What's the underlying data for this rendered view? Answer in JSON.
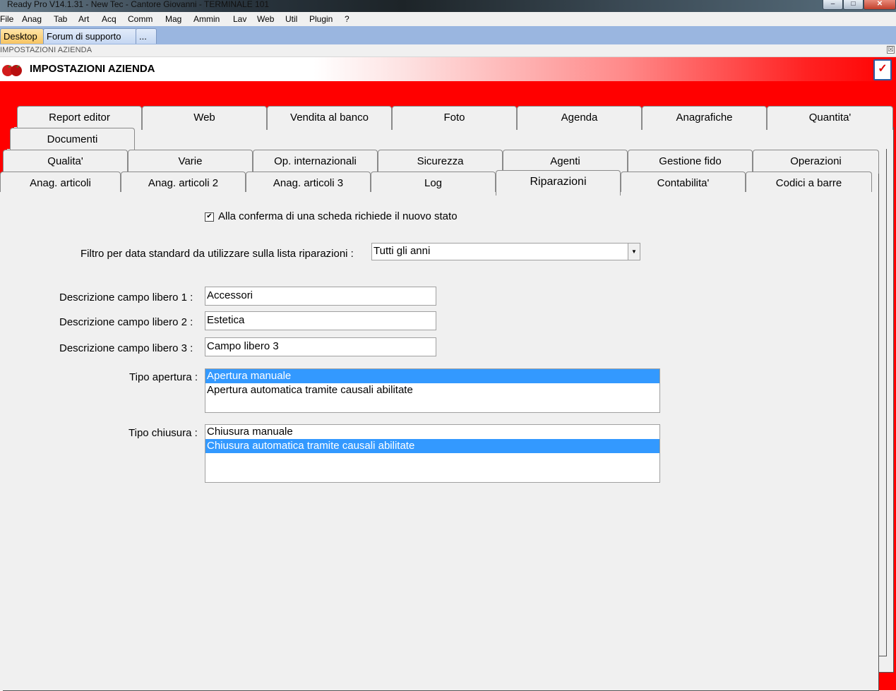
{
  "window": {
    "title": "Ready Pro V14.1.31 - New Tec - Cantore Giovanni - TERMINALE 101",
    "minimize": "–",
    "maximize": "□",
    "close": "✕"
  },
  "menu": [
    "File",
    "Anag",
    "Tab",
    "Art",
    "Acq",
    "Comm",
    "Mag",
    "Ammin",
    "Lav",
    "Web",
    "Util",
    "Plugin",
    "?"
  ],
  "doc_tabs": [
    {
      "label": "Desktop",
      "active": true
    },
    {
      "label": "Forum di supporto",
      "active": false
    },
    {
      "label": "...",
      "active": false
    }
  ],
  "caption": {
    "title": "IMPOSTAZIONI AZIENDA",
    "close": "☒"
  },
  "header": {
    "title": "IMPOSTAZIONI AZIENDA",
    "confirm_icon": "checklist-icon"
  },
  "tabs": {
    "row1": [
      "Report editor",
      "Web",
      "Vendita al banco",
      "Foto",
      "Agenda",
      "Anagrafiche",
      "Quantita'"
    ],
    "row2": [
      "Documenti"
    ],
    "row3": [
      "Qualita'",
      "Varie",
      "Op. internazionali",
      "Sicurezza",
      "Agenti",
      "Gestione fido",
      "Operazioni"
    ],
    "row4": [
      "Anag. articoli",
      "Anag. articoli 2",
      "Anag. articoli 3",
      "Log",
      "Riparazioni",
      "Contabilita'",
      "Codici a barre"
    ],
    "active": "Riparazioni"
  },
  "form": {
    "checkbox_label": "Alla conferma di una scheda richiede il nuovo stato",
    "checkbox_checked": true,
    "filter_label": "Filtro per data standard da utilizzare sulla lista riparazioni :",
    "filter_value": "Tutti gli anni",
    "field1_label": "Descrizione campo libero 1 :",
    "field1_value": "Accessori",
    "field2_label": "Descrizione campo libero 2 :",
    "field2_value": "Estetica",
    "field3_label": "Descrizione campo libero 3 :",
    "field3_value": "Campo libero 3",
    "apertura_label": "Tipo apertura :",
    "apertura_options": [
      "Apertura manuale",
      "Apertura automatica tramite causali abilitate"
    ],
    "apertura_selected": 0,
    "chiusura_label": "Tipo chiusura :",
    "chiusura_options": [
      "Chiusura manuale",
      "Chiusura automatica tramite causali abilitate"
    ],
    "chiusura_selected": 1
  }
}
